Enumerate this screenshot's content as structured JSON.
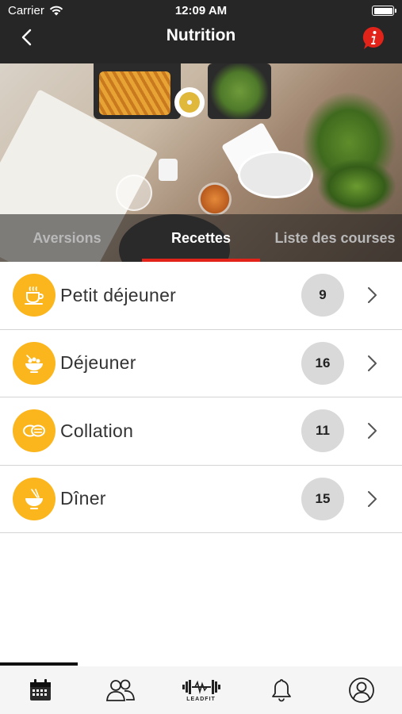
{
  "status_bar": {
    "carrier": "Carrier",
    "time": "12:09 AM"
  },
  "nav": {
    "title": "Nutrition",
    "back_icon": "chevron-left-icon",
    "info_icon": "info-icon"
  },
  "hero": {
    "tabs": [
      {
        "label": "Aversions",
        "active": false
      },
      {
        "label": "Recettes",
        "active": true
      },
      {
        "label": "Liste des courses",
        "active": false
      }
    ]
  },
  "categories": [
    {
      "label": "Petit déjeuner",
      "count": "9",
      "icon": "coffee-cup-icon"
    },
    {
      "label": "Déjeuner",
      "count": "16",
      "icon": "salad-bowl-icon"
    },
    {
      "label": "Collation",
      "count": "11",
      "icon": "snack-icon"
    },
    {
      "label": "Dîner",
      "count": "15",
      "icon": "noodle-bowl-icon"
    }
  ],
  "bottom_nav": {
    "items": [
      "calendar-icon",
      "users-icon",
      "leadfit-logo",
      "bell-icon",
      "profile-icon"
    ],
    "logo_text": "LEADFIT"
  },
  "colors": {
    "accent": "#e2231a",
    "category_icon_bg": "#fbb61e",
    "header_bg": "#262626"
  }
}
